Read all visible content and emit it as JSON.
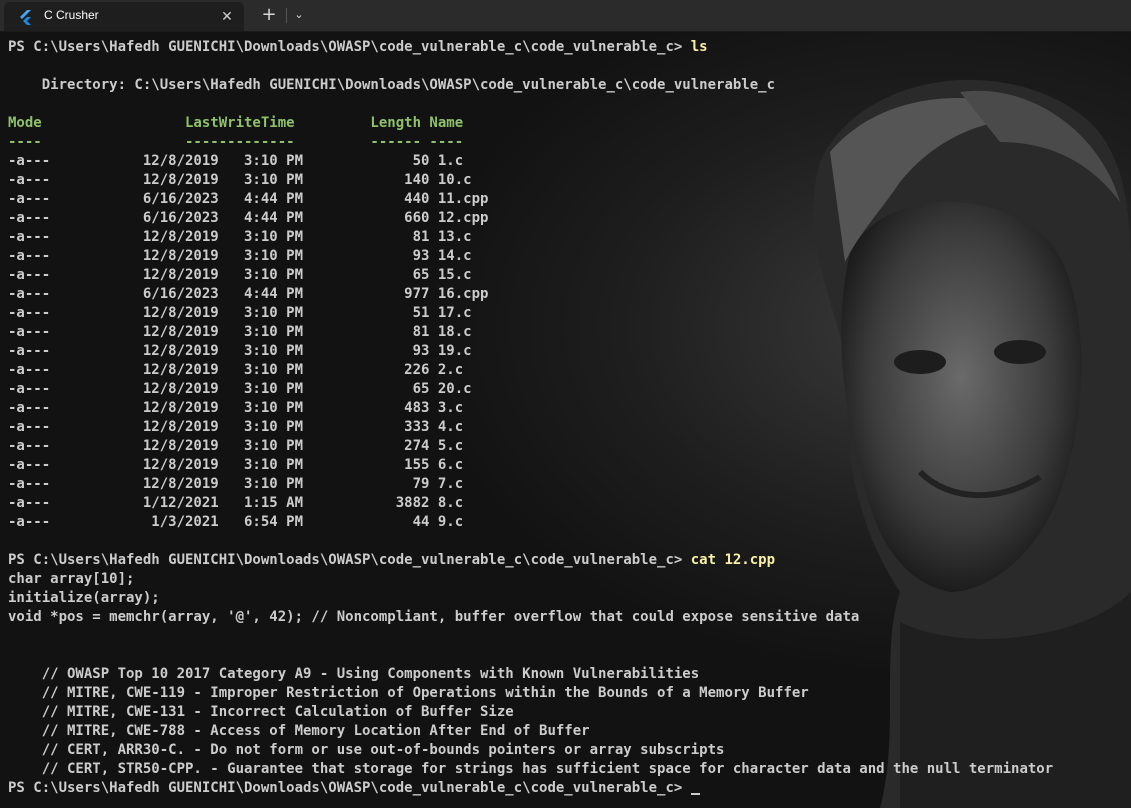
{
  "tab": {
    "title": "C Crusher",
    "close_icon": "close-icon",
    "new_tab_label": "+",
    "dropdown_icon": "chevron-down-icon"
  },
  "colors": {
    "terminal_bg": "#0c0c0c",
    "text": "#cccccc",
    "command": "#f9f1a5",
    "table_header": "#8fc16a"
  },
  "terminal": {
    "prompt": "PS C:\\Users\\Hafedh GUENICHI\\Downloads\\OWASP\\code_vulnerable_c\\code_vulnerable_c> ",
    "cmd1": "ls",
    "directory_line": "    Directory: C:\\Users\\Hafedh GUENICHI\\Downloads\\OWASP\\code_vulnerable_c\\code_vulnerable_c",
    "header_line": "Mode                 LastWriteTime         Length Name",
    "underline_line": "----                 -------------         ------ ----",
    "files": [
      "-a---           12/8/2019   3:10 PM             50 1.c",
      "-a---           12/8/2019   3:10 PM            140 10.c",
      "-a---           6/16/2023   4:44 PM            440 11.cpp",
      "-a---           6/16/2023   4:44 PM            660 12.cpp",
      "-a---           12/8/2019   3:10 PM             81 13.c",
      "-a---           12/8/2019   3:10 PM             93 14.c",
      "-a---           12/8/2019   3:10 PM             65 15.c",
      "-a---           6/16/2023   4:44 PM            977 16.cpp",
      "-a---           12/8/2019   3:10 PM             51 17.c",
      "-a---           12/8/2019   3:10 PM             81 18.c",
      "-a---           12/8/2019   3:10 PM             93 19.c",
      "-a---           12/8/2019   3:10 PM            226 2.c",
      "-a---           12/8/2019   3:10 PM             65 20.c",
      "-a---           12/8/2019   3:10 PM            483 3.c",
      "-a---           12/8/2019   3:10 PM            333 4.c",
      "-a---           12/8/2019   3:10 PM            274 5.c",
      "-a---           12/8/2019   3:10 PM            155 6.c",
      "-a---           12/8/2019   3:10 PM             79 7.c",
      "-a---           1/12/2021   1:15 AM           3882 8.c",
      "-a---            1/3/2021   6:54 PM             44 9.c"
    ],
    "cmd2": "cat 12.cpp",
    "code_lines": [
      "char array[10];",
      "initialize(array);",
      "void *pos = memchr(array, '@', 42); // Noncompliant, buffer overflow that could expose sensitive data"
    ],
    "comment_lines": [
      "    // OWASP Top 10 2017 Category A9 - Using Components with Known Vulnerabilities",
      "    // MITRE, CWE-119 - Improper Restriction of Operations within the Bounds of a Memory Buffer",
      "    // MITRE, CWE-131 - Incorrect Calculation of Buffer Size",
      "    // MITRE, CWE-788 - Access of Memory Location After End of Buffer",
      "    // CERT, ARR30-C. - Do not form or use out-of-bounds pointers or array subscripts",
      "    // CERT, STR50-CPP. - Guarantee that storage for strings has sufficient space for character data and the null terminator"
    ]
  }
}
